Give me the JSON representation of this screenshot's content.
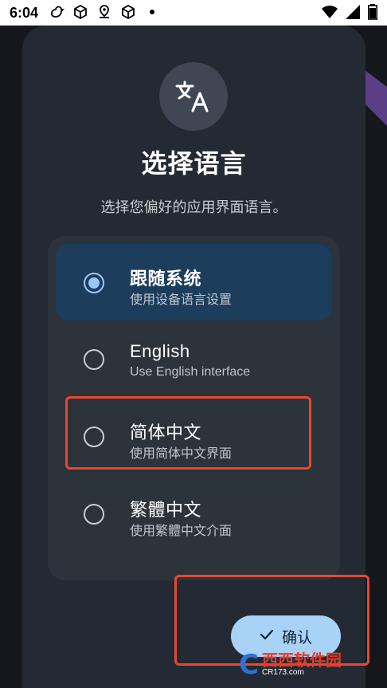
{
  "status_bar": {
    "time": "6:04",
    "icons": [
      "duck-icon",
      "cube-icon",
      "location-icon",
      "cube-icon"
    ],
    "right_icons": [
      "wifi-icon",
      "signal-icon",
      "battery-icon"
    ]
  },
  "dialog": {
    "icon": "translate-icon",
    "title": "选择语言",
    "subtitle": "选择您偏好的应用界面语言。",
    "options": [
      {
        "title": "跟随系统",
        "subtitle": "使用设备语言设置",
        "selected": true
      },
      {
        "title": "English",
        "subtitle": "Use English interface",
        "selected": false
      },
      {
        "title": "简体中文",
        "subtitle": "使用简体中文界面",
        "selected": false
      },
      {
        "title": "繁體中文",
        "subtitle": "使用繁體中文介面",
        "selected": false
      }
    ],
    "confirm_label": "确认"
  },
  "watermark": {
    "main": "西西软件园",
    "url": "CR173.com"
  },
  "colors": {
    "dialog_bg": "#242a33",
    "card_bg": "#2d333b",
    "selected_bg": "#1c3d5c",
    "accent": "#9bc6f8",
    "confirm_bg": "#a9d2f7",
    "highlight_box": "#e8472f"
  }
}
